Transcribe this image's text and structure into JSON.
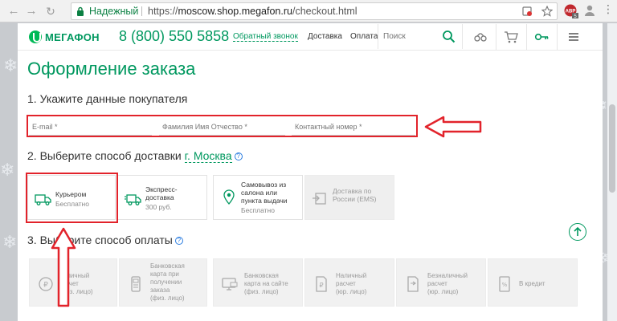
{
  "browser": {
    "secure_label": "Надежный",
    "url_scheme": "https://",
    "url_host": "moscow.shop.megafon.ru",
    "url_path": "/checkout.html",
    "ext_badge": "ABP",
    "ext_count": "5"
  },
  "header": {
    "logo_text": "МЕГАФОН",
    "phone": "8 (800) 550 5858",
    "callback_label": "Обратный звонок",
    "nav": [
      "Доставка",
      "Оплата"
    ],
    "search_placeholder": "Поиск",
    "icons": [
      "search-icon",
      "compare-icon",
      "cart-icon",
      "key-icon",
      "menu-icon"
    ]
  },
  "checkout": {
    "title": "Оформление заказа",
    "step1": "1. Укажите данные покупателя",
    "fields": {
      "email_placeholder": "E-mail *",
      "name_placeholder": "Фамилия Имя Отчество *",
      "phone_placeholder": "Контактный номер *"
    },
    "step2": "2. Выберите способ доставки",
    "city": "г. Москва",
    "delivery": [
      {
        "line1": "Курьером",
        "line2": "",
        "line3": "",
        "sub": "Бесплатно",
        "icon": "truck-icon"
      },
      {
        "line1": "Экспресс-",
        "line2": "доставка",
        "line3": "",
        "sub": "300 руб.",
        "icon": "fast-truck-icon"
      },
      {
        "line1": "Самовывоз из",
        "line2": "салона или",
        "line3": "пункта выдачи",
        "sub": "Бесплатно",
        "icon": "pin-icon"
      },
      {
        "line1": "Доставка по",
        "line2": "России (EMS)",
        "line3": "",
        "sub": "",
        "icon": "ems-icon"
      }
    ],
    "step3": "3. Выберите способ оплаты",
    "payment": [
      {
        "lines": [
          "Наличный",
          "расчет",
          "(физ. лицо)"
        ],
        "icon": "cash-icon"
      },
      {
        "lines": [
          "Банковская",
          "карта при",
          "получении",
          "заказа",
          "(физ. лицо)"
        ],
        "icon": "card-terminal-icon"
      },
      {
        "lines": [
          "Банковская",
          "карта на сайте",
          "(физ. лицо)"
        ],
        "icon": "online-card-icon"
      },
      {
        "lines": [
          "Наличный",
          "расчет",
          "(юр. лицо)"
        ],
        "icon": "invoice-icon"
      },
      {
        "lines": [
          "Безналичный",
          "расчет",
          "(юр. лицо)"
        ],
        "icon": "transfer-icon"
      },
      {
        "lines": [
          "В кредит"
        ],
        "icon": "credit-icon"
      }
    ]
  },
  "colors": {
    "brand_green": "#00985f",
    "annotation_red": "#e2232b"
  }
}
